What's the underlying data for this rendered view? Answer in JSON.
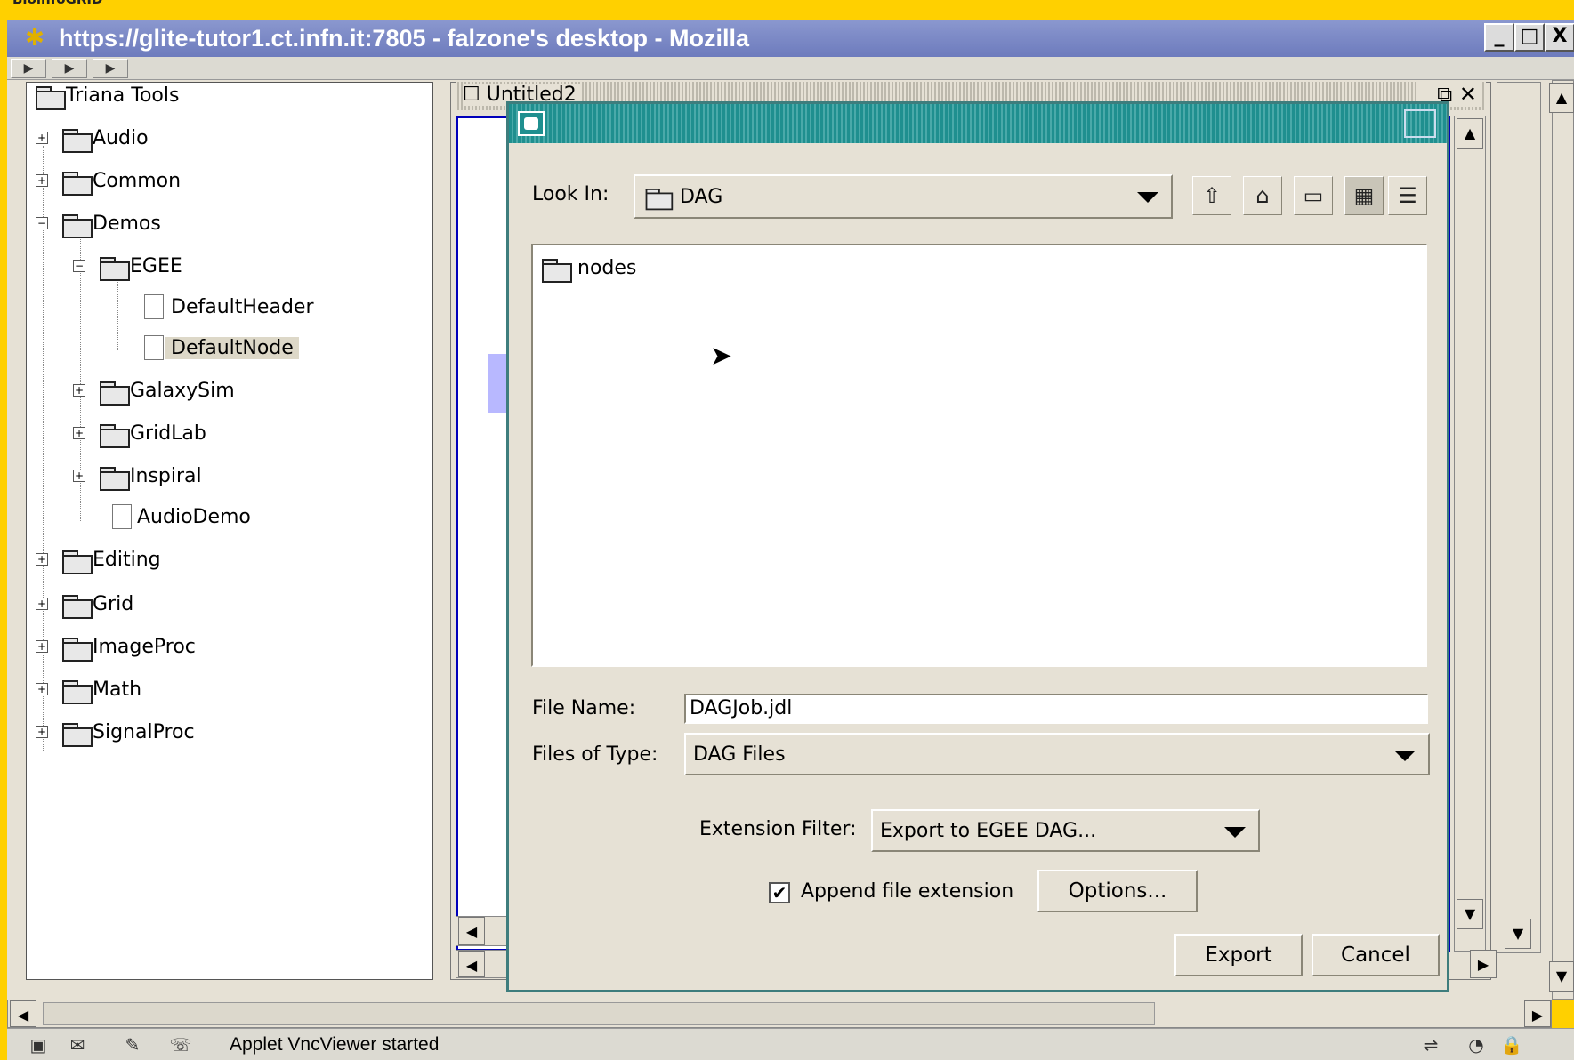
{
  "top_strip_label": "BioinfoGRID",
  "browser": {
    "title": "https://glite-tutor1.ct.infn.it:7805 - falzone's desktop - Mozilla",
    "min_label": "_",
    "max_label": "□",
    "close_label": "X"
  },
  "tree": {
    "root": "Triana Tools",
    "items": [
      {
        "label": "Audio",
        "expander": "+"
      },
      {
        "label": "Common",
        "expander": "+"
      },
      {
        "label": "Demos",
        "expander": "−"
      },
      {
        "label": "EGEE",
        "expander": "−"
      },
      {
        "label": "DefaultHeader"
      },
      {
        "label": "DefaultNode"
      },
      {
        "label": "GalaxySim",
        "expander": "+"
      },
      {
        "label": "GridLab",
        "expander": "+"
      },
      {
        "label": "Inspiral",
        "expander": "+"
      },
      {
        "label": "AudioDemo"
      },
      {
        "label": "Editing",
        "expander": "+"
      },
      {
        "label": "Grid",
        "expander": "+"
      },
      {
        "label": "ImageProc",
        "expander": "+"
      },
      {
        "label": "Math",
        "expander": "+"
      },
      {
        "label": "SignalProc",
        "expander": "+"
      }
    ]
  },
  "inner_window": {
    "title": "Untitled2",
    "controls": "_ ⧉ ✕"
  },
  "dialog": {
    "look_in_label": "Look In:",
    "look_in_value": "DAG",
    "files": [
      "nodes"
    ],
    "file_name_label": "File Name:",
    "file_name_value": "DAGJob.jdl",
    "files_of_type_label": "Files of Type:",
    "files_of_type_value": "DAG Files",
    "extension_filter_label": "Extension Filter:",
    "extension_filter_value": "Export to EGEE DAG...",
    "append_label": "Append file extension",
    "append_checked": true,
    "options_label": "Options...",
    "export_label": "Export",
    "cancel_label": "Cancel"
  },
  "status": {
    "text": "Applet VncViewer started"
  },
  "icons": {
    "app": "mozilla-icon",
    "up_folder": "up-folder-icon",
    "home": "home-icon",
    "new_folder": "new-folder-icon",
    "list_view": "list-view-icon",
    "details_view": "details-view-icon"
  },
  "colors": {
    "accent_yellow": "#ffd000",
    "title_blue": "#7480c4",
    "dialog_teal": "#1f8f8f"
  }
}
